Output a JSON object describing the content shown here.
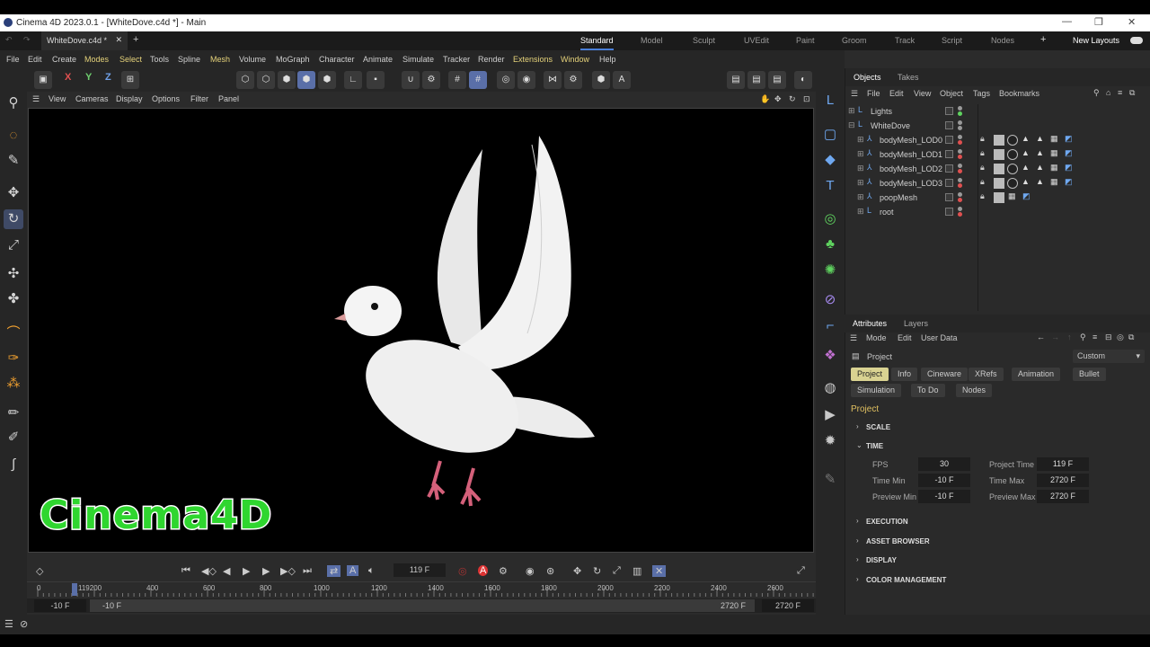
{
  "window": {
    "title": "Cinema 4D 2023.0.1 - [WhiteDove.c4d *] - Main"
  },
  "doc_tab": {
    "label": "WhiteDove.c4d *"
  },
  "layouts": [
    "Standard",
    "Model",
    "Sculpt",
    "UVEdit",
    "Paint",
    "Groom",
    "Track",
    "Script",
    "Nodes"
  ],
  "new_layouts": "New Layouts",
  "menus": [
    "File",
    "Edit",
    "Create",
    "Modes",
    "Select",
    "Tools",
    "Spline",
    "Mesh",
    "Volume",
    "MoGraph",
    "Character",
    "Animate",
    "Simulate",
    "Tracker",
    "Render",
    "Extensions",
    "Window",
    "Help"
  ],
  "axes": {
    "x": "X",
    "y": "Y",
    "z": "Z"
  },
  "viewport_menu": [
    "View",
    "Cameras",
    "Display",
    "Options",
    "Filter",
    "Panel"
  ],
  "watermark": "Cinema4D",
  "objects_panel": {
    "tabs": [
      "Objects",
      "Takes"
    ],
    "menu": [
      "File",
      "Edit",
      "View",
      "Object",
      "Tags",
      "Bookmarks"
    ],
    "items": [
      {
        "name": "Lights",
        "indent": 0
      },
      {
        "name": "WhiteDove",
        "indent": 0
      },
      {
        "name": "bodyMesh_LOD0",
        "indent": 1
      },
      {
        "name": "bodyMesh_LOD1",
        "indent": 1
      },
      {
        "name": "bodyMesh_LOD2",
        "indent": 1
      },
      {
        "name": "bodyMesh_LOD3",
        "indent": 1
      },
      {
        "name": "poopMesh",
        "indent": 1
      },
      {
        "name": "root",
        "indent": 1
      }
    ]
  },
  "attributes_panel": {
    "tabs": [
      "Attributes",
      "Layers"
    ],
    "menu": [
      "Mode",
      "Edit",
      "User Data"
    ],
    "object": "Project",
    "dropdown": "Custom",
    "buttons_row1": [
      "Project",
      "Info",
      "Cineware",
      "XRefs",
      "Animation",
      "Bullet"
    ],
    "buttons_row2": [
      "Simulation",
      "To Do",
      "Nodes"
    ],
    "section_title": "Project",
    "sections": [
      "SCALE",
      "TIME",
      "EXECUTION",
      "ASSET BROWSER",
      "DISPLAY",
      "COLOR MANAGEMENT"
    ],
    "fields": {
      "fps_label": "FPS",
      "fps": "30",
      "project_time_label": "Project Time",
      "project_time": "119 F",
      "time_min_label": "Time Min",
      "time_min": "-10 F",
      "time_max_label": "Time Max",
      "time_max": "2720 F",
      "preview_min_label": "Preview Min",
      "preview_min": "-10 F",
      "preview_max_label": "Preview Max",
      "preview_max": "2720 F"
    }
  },
  "timeline": {
    "current_frame": "119 F",
    "ruler_ticks": [
      "0",
      "119200",
      "400",
      "600",
      "800",
      "1000",
      "1200",
      "1400",
      "1600",
      "1800",
      "2000",
      "2200",
      "2400",
      "2600"
    ],
    "range_start": "-10 F",
    "range_start2": "-10 F",
    "range_end": "2720 F",
    "range_end2": "2720 F"
  }
}
